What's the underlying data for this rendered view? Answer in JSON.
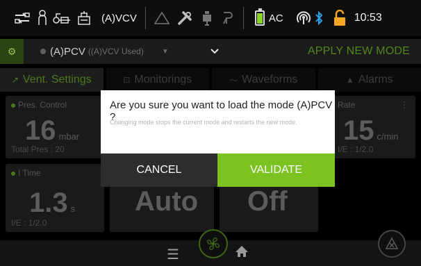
{
  "status_bar": {
    "mode": "(A)VCV",
    "power_source": "AC",
    "time": "10:53",
    "battery_level_percent": 85,
    "icons": [
      "network-icon",
      "patient-icon",
      "circuit-icon",
      "humidifier-icon",
      "warning-triangle-icon",
      "tools-icon",
      "accessory-icon",
      "oxygen-icon",
      "battery-icon",
      "wireless-icon",
      "bluetooth-icon",
      "unlock-icon"
    ]
  },
  "mode_bar": {
    "selected_mode": "(A)PCV",
    "used_mode_note": "((A)VCV Used)",
    "apply_label": "APPLY NEW MODE"
  },
  "tabs": [
    {
      "label": "Vent. Settings",
      "icon": "pencil-icon",
      "active": true
    },
    {
      "label": "Monitorings",
      "icon": "monitor-icon",
      "active": false
    },
    {
      "label": "Waveforms",
      "icon": "wave-icon",
      "active": false
    },
    {
      "label": "Alarms",
      "icon": "bell-icon",
      "active": false
    }
  ],
  "settings": {
    "pres_control": {
      "label": "Pres. Control",
      "value": "16",
      "unit": "mbar",
      "sub": "Total Pres : 20"
    },
    "rate": {
      "label": "Rate",
      "value": "15",
      "unit": "c/min",
      "sub": "I/E : 1/2.0"
    },
    "i_time": {
      "label": "I Time",
      "value": "1.3",
      "unit": "s",
      "sub": "I/E : 1/2.0"
    },
    "tile2": {
      "value": "Auto"
    },
    "tile3": {
      "value": "Off"
    }
  },
  "dialog": {
    "title": "Are you sure you want to load the mode (A)PCV ?",
    "message": "Changing mode stops the current mode and restarts the new mode.",
    "cancel_label": "CANCEL",
    "validate_label": "VALIDATE"
  },
  "colors": {
    "accent_green": "#7cc221",
    "dark_green": "#4c7a1a",
    "battery_green": "#8bd12a",
    "bluetooth_blue": "#2aa0e8",
    "lock_orange": "#f5a623"
  }
}
